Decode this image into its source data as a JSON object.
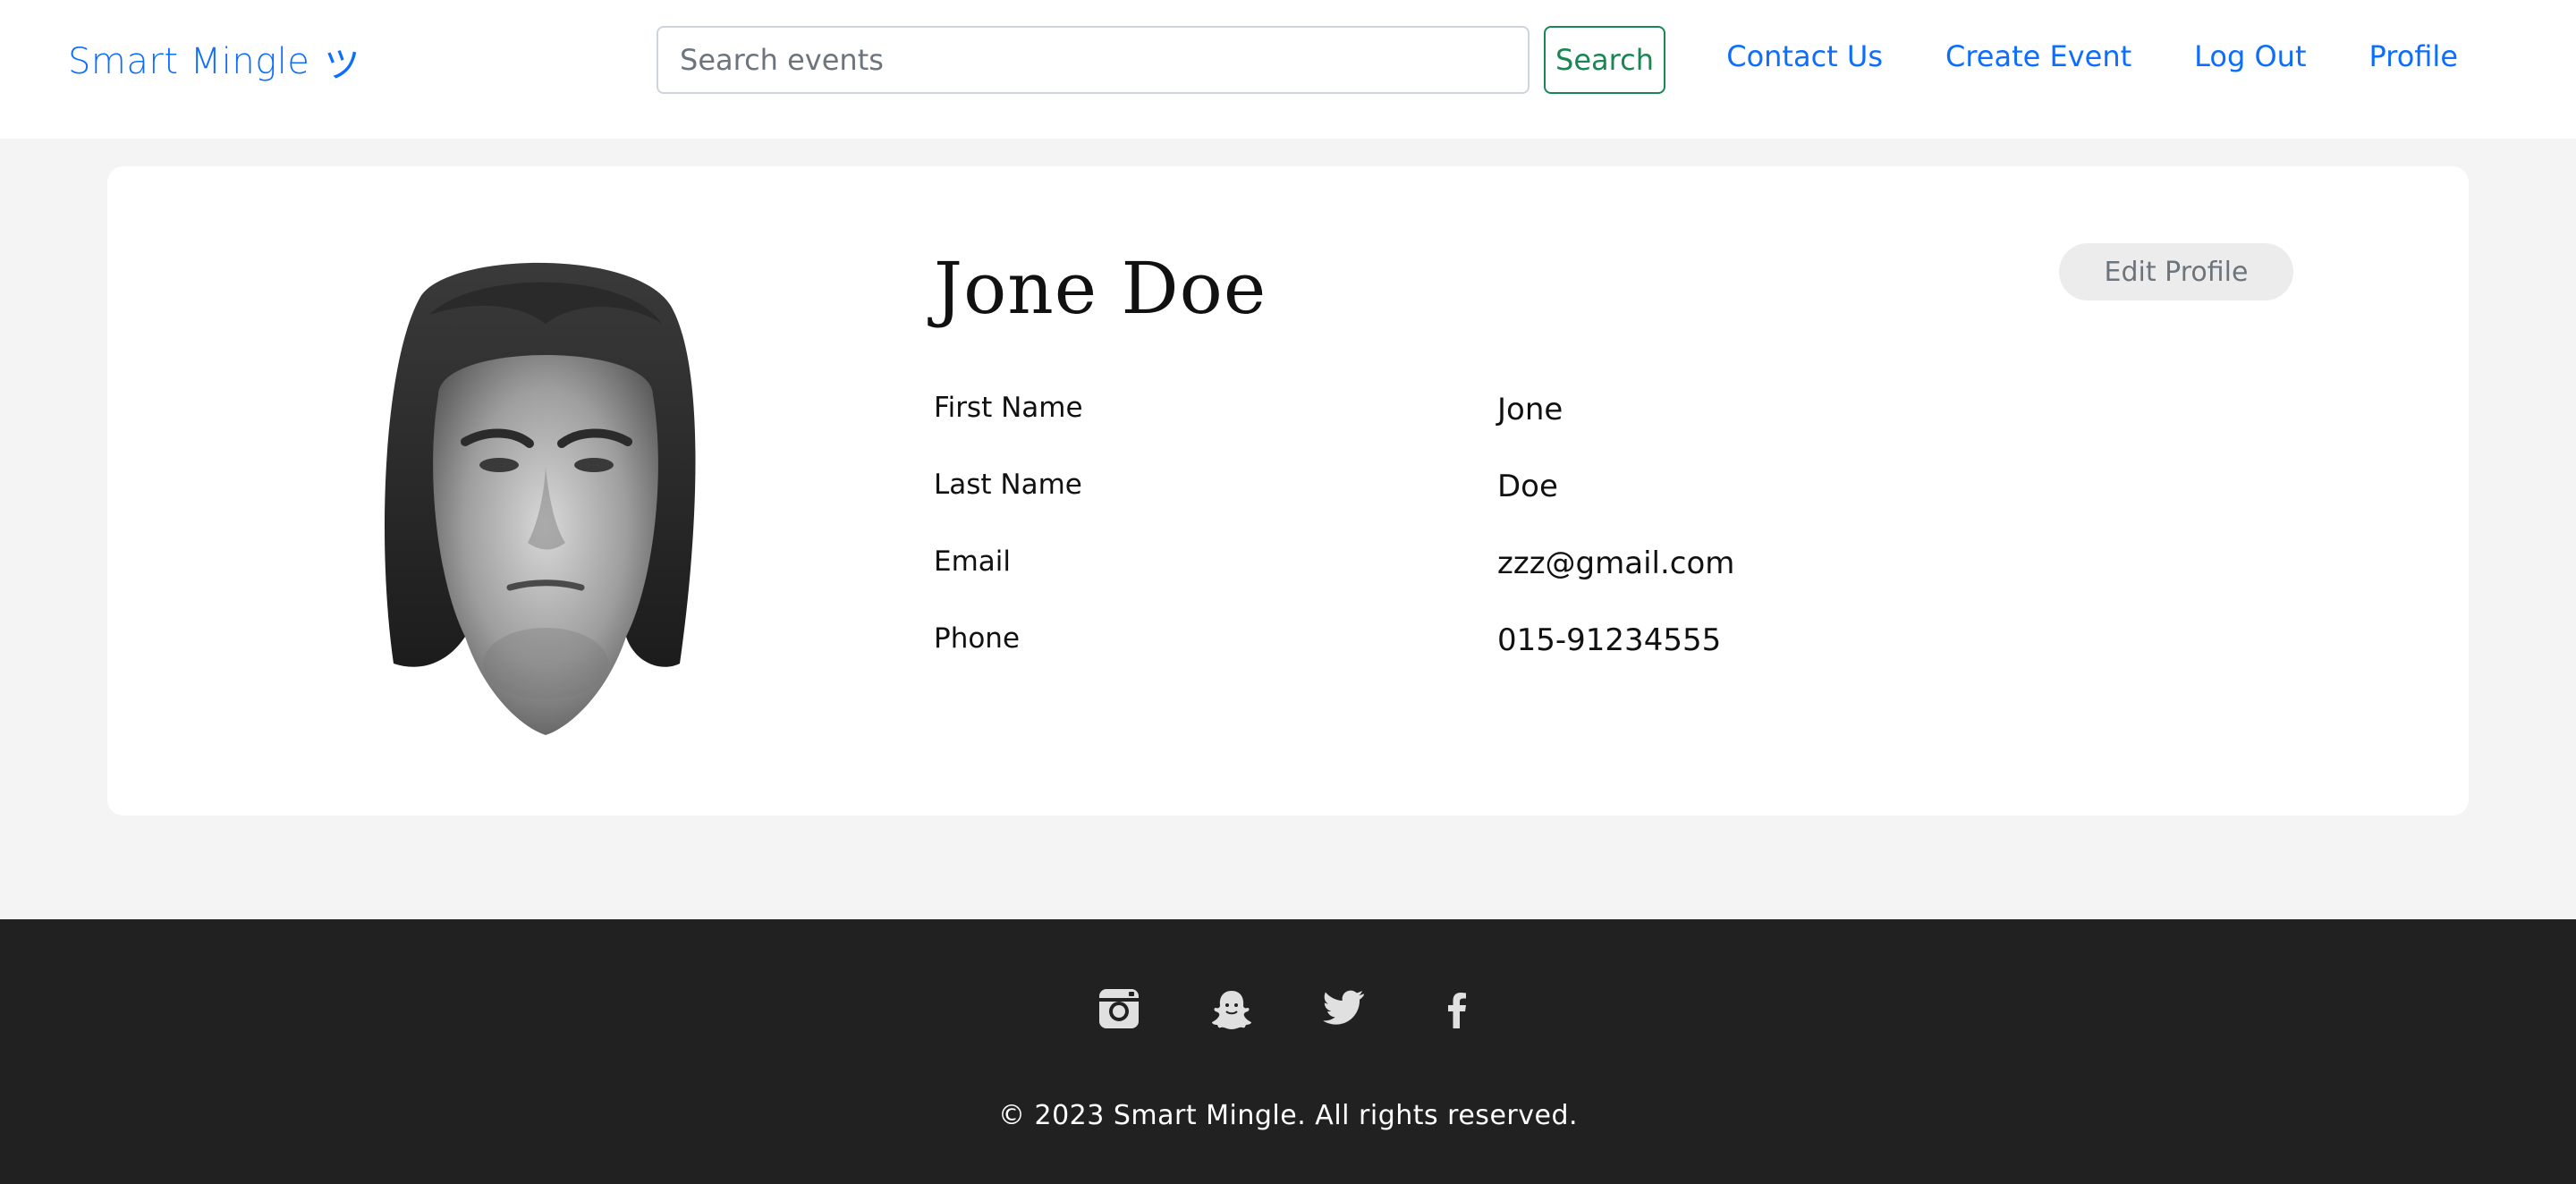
{
  "header": {
    "brand": "Smart Mingle",
    "brand_mark": "ツ",
    "search_placeholder": "Search events",
    "search_button": "Search",
    "nav": [
      "Contact Us",
      "Create Event",
      "Log Out",
      "Profile"
    ]
  },
  "profile": {
    "name": "Jone Doe",
    "edit_button": "Edit Profile",
    "fields": [
      {
        "label": "First Name",
        "value": "Jone"
      },
      {
        "label": "Last Name",
        "value": "Doe"
      },
      {
        "label": "Email",
        "value": "zzz@gmail.com"
      },
      {
        "label": "Phone",
        "value": "015-91234555"
      }
    ]
  },
  "footer": {
    "social_icons": [
      "instagram-icon",
      "snapchat-icon",
      "twitter-icon",
      "facebook-icon"
    ],
    "copyright": "© 2023 Smart Mingle. All rights reserved."
  },
  "colors": {
    "link": "#0d6efd",
    "search_green": "#198754",
    "footer_bg": "#212121",
    "page_bg": "#f4f4f4"
  }
}
